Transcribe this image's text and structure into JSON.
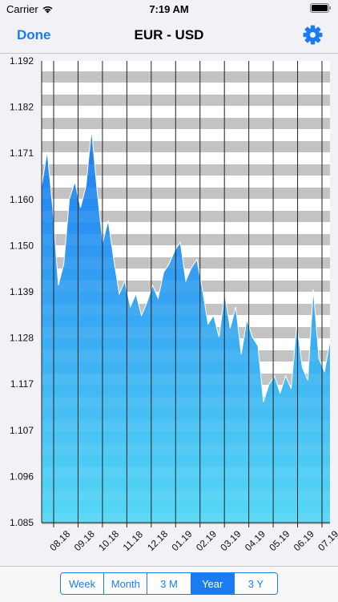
{
  "status_bar": {
    "carrier": "Carrier",
    "time": "7:19 AM"
  },
  "nav": {
    "done_label": "Done",
    "title": "EUR - USD",
    "settings_icon": "gear-icon"
  },
  "colors": {
    "accent": "#1a7cf0",
    "stripe": "#c0c0c0",
    "area_top": "#1e7cf0",
    "area_bottom": "#55d8f5"
  },
  "segments": [
    {
      "label": "Week",
      "active": false
    },
    {
      "label": "Month",
      "active": false
    },
    {
      "label": "3 M",
      "active": false
    },
    {
      "label": "Year",
      "active": true
    },
    {
      "label": "3 Y",
      "active": false
    }
  ],
  "chart_data": {
    "type": "area",
    "title": "",
    "xlabel": "",
    "ylabel": "",
    "ylim": [
      1.085,
      1.192
    ],
    "y_ticks": [
      "1.192",
      "1.182",
      "1.171",
      "1.160",
      "1.150",
      "1.139",
      "1.128",
      "1.117",
      "1.107",
      "1.096",
      "1.085"
    ],
    "x_ticks": [
      "08.18",
      "09.18",
      "10.18",
      "11.18",
      "12.18",
      "01.19",
      "02.19",
      "03.19",
      "04.19",
      "05.19",
      "06.19",
      "07.19"
    ],
    "grid": true,
    "series": [
      {
        "x": [
          "2018-07-20",
          "2018-07-27",
          "2018-08-03",
          "2018-08-10",
          "2018-08-17",
          "2018-08-24",
          "2018-08-31",
          "2018-09-07",
          "2018-09-14",
          "2018-09-21",
          "2018-09-28",
          "2018-10-05",
          "2018-10-12",
          "2018-10-19",
          "2018-10-26",
          "2018-11-02",
          "2018-11-09",
          "2018-11-16",
          "2018-11-23",
          "2018-11-30",
          "2018-12-07",
          "2018-12-14",
          "2018-12-21",
          "2018-12-28",
          "2019-01-04",
          "2019-01-11",
          "2019-01-18",
          "2019-01-25",
          "2019-02-01",
          "2019-02-08",
          "2019-02-15",
          "2019-02-22",
          "2019-03-01",
          "2019-03-08",
          "2019-03-15",
          "2019-03-22",
          "2019-03-29",
          "2019-04-05",
          "2019-04-12",
          "2019-04-19",
          "2019-04-26",
          "2019-05-03",
          "2019-05-10",
          "2019-05-17",
          "2019-05-24",
          "2019-05-31",
          "2019-06-07",
          "2019-06-14",
          "2019-06-21",
          "2019-06-28",
          "2019-07-05",
          "2019-07-12",
          "2019-07-19"
        ],
        "y": [
          1.163,
          1.171,
          1.158,
          1.14,
          1.145,
          1.16,
          1.164,
          1.158,
          1.163,
          1.176,
          1.162,
          1.15,
          1.155,
          1.146,
          1.138,
          1.141,
          1.135,
          1.138,
          1.133,
          1.136,
          1.14,
          1.137,
          1.143,
          1.145,
          1.148,
          1.15,
          1.141,
          1.144,
          1.146,
          1.139,
          1.131,
          1.133,
          1.128,
          1.138,
          1.13,
          1.135,
          1.124,
          1.132,
          1.128,
          1.126,
          1.113,
          1.117,
          1.119,
          1.115,
          1.119,
          1.116,
          1.131,
          1.121,
          1.118,
          1.139,
          1.123,
          1.12,
          1.127
        ]
      }
    ]
  }
}
